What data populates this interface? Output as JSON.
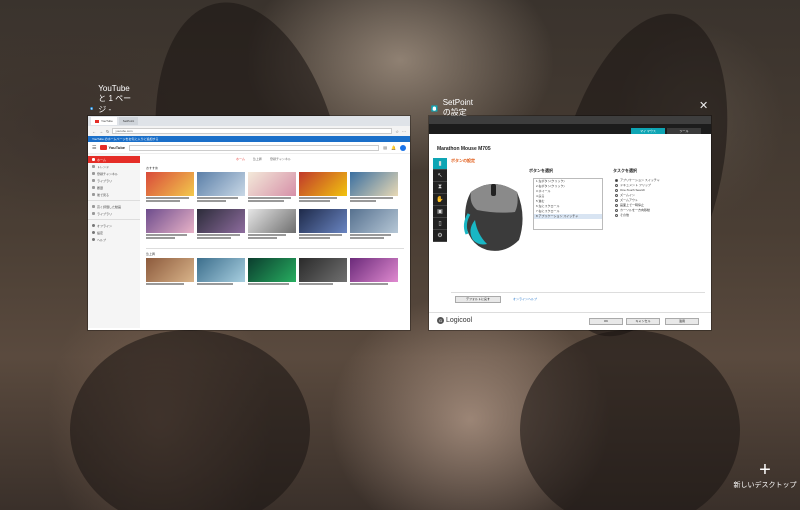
{
  "windows": {
    "edge": {
      "title": "YouTube と 1 ページ - Microsoft Edge",
      "tabs": [
        "YouTube",
        "SetPoint"
      ],
      "url": "youtube.com",
      "favorites_text": "YouTube のホームページをお気に入りに追加する",
      "youtube": {
        "sidebar": [
          "ホーム",
          "トレンド",
          "登録チャンネル",
          "ライブラリ",
          "履歴",
          "後で見る",
          "高く評価した動画",
          "ライブラリ",
          "オフライン",
          "設定",
          "ヘルプ"
        ],
        "tabs": [
          "ホーム",
          "急上昇",
          "登録チャンネル"
        ],
        "section1": "おすすめ",
        "section2": "急上昇"
      }
    },
    "setpoint": {
      "title": "SetPoint の設定",
      "top_tabs": [
        "マイ マウス",
        "ツール"
      ],
      "product": "Marathon Mouse M705",
      "section": "ボタンの設定",
      "buttons_label": "ボタンを選択",
      "buttons": [
        "1 左ボタン(クリック)",
        "2 右ボタン(クリック)",
        "3 ホイール",
        "4 戻る",
        "5 進む",
        "6 左にスクロール",
        "7 右にスクロール",
        "8 アプリケーション スイッチャ"
      ],
      "task_label": "タスクを選択",
      "tasks": [
        "アプリケーション スイッチャ",
        "ドキュメント フリップ",
        "One-Touch Search",
        "ズームイン",
        "ズームアウト",
        "画面上で一時停止",
        "カーソルを一方向移動",
        "その他"
      ],
      "default_button": "デフォルトに戻す",
      "help_link": "オンラインヘルプ",
      "ok": "OK",
      "cancel": "キャンセル",
      "apply": "適用",
      "brand": "Logicool"
    }
  },
  "new_desktop": {
    "label": "新しいデスクトップ",
    "icon": "plus-icon"
  },
  "colors": {
    "youtube_red": "#e52d27",
    "setpoint_accent": "#0ea5b4",
    "setpoint_orange": "#e05a16",
    "edge_blue": "#1a6fc9"
  }
}
